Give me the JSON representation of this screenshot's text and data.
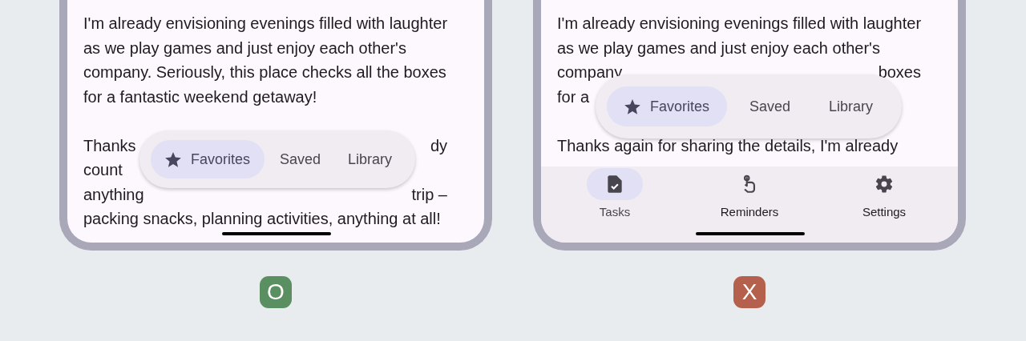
{
  "phones": [
    {
      "paragraphs": [
        [
          [
            "I'm already envisioning evenings filled with laughter"
          ],
          [
            "as we play games and just enjoy each other's"
          ],
          [
            "company. Seriously, this place checks all the boxes"
          ],
          [
            "for a fantastic weekend getaway!"
          ]
        ],
        [
          [
            "Thanks",
            "dy"
          ],
          [
            "count"
          ],
          [
            "anything",
            "trip –"
          ],
          [
            "packing snacks, planning activities, anything at all!"
          ]
        ]
      ],
      "toolbar": {
        "items": [
          {
            "label": "Favorites",
            "selected": true
          },
          {
            "label": "Saved",
            "selected": false
          },
          {
            "label": "Library",
            "selected": false
          }
        ]
      },
      "verdict": {
        "label": "O",
        "color": "#5a8f62"
      }
    },
    {
      "paragraphs": [
        [
          [
            "I'm already envisioning evenings filled with laughter"
          ],
          [
            "as we play games and just enjoy each other's"
          ],
          [
            "company",
            "boxes"
          ],
          [
            "for a"
          ]
        ],
        [
          [
            "Thanks again for sharing the details, I'm already"
          ]
        ]
      ],
      "toolbar": {
        "items": [
          {
            "label": "Favorites",
            "selected": true
          },
          {
            "label": "Saved",
            "selected": false
          },
          {
            "label": "Library",
            "selected": false
          }
        ]
      },
      "nav": {
        "items": [
          {
            "label": "Tasks",
            "selected": true
          },
          {
            "label": "Reminders",
            "selected": false
          },
          {
            "label": "Settings",
            "selected": false
          }
        ]
      },
      "verdict": {
        "label": "X",
        "color": "#b5604c"
      }
    }
  ]
}
